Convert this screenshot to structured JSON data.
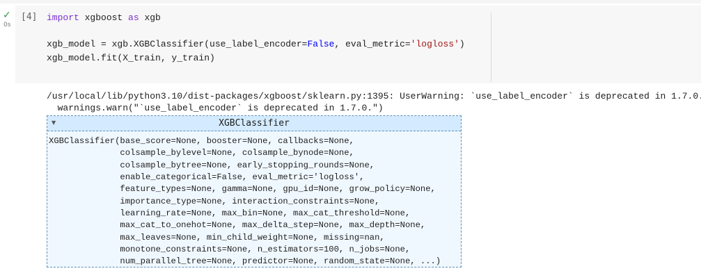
{
  "cell": {
    "status_icon": "check-icon",
    "elapsed": "0s",
    "execution_count": "[4]",
    "code": {
      "line1": {
        "kw_import": "import",
        "module": " xgboost ",
        "kw_as": "as",
        "alias": " xgb"
      },
      "line2": {
        "prefix": "xgb_model = xgb.XGBClassifier(use_label_encoder=",
        "false_lit": "False",
        "middle": ", eval_metric=",
        "metric_str": "'logloss'",
        "suffix": ")"
      },
      "line3": "xgb_model.fit(X_train, y_train)"
    }
  },
  "output": {
    "warning_line1": "/usr/local/lib/python3.10/dist-packages/xgboost/sklearn.py:1395: UserWarning: `use_label_encoder` is deprecated in 1.7.0.",
    "warning_line2": "  warnings.warn(\"`use_label_encoder` is deprecated in 1.7.0.\")",
    "estimator": {
      "toggle_icon": "triangle-down-icon",
      "title": "XGBClassifier",
      "repr_lines": [
        "XGBClassifier(base_score=None, booster=None, callbacks=None,",
        "              colsample_bylevel=None, colsample_bynode=None,",
        "              colsample_bytree=None, early_stopping_rounds=None,",
        "              enable_categorical=False, eval_metric='logloss',",
        "              feature_types=None, gamma=None, gpu_id=None, grow_policy=None,",
        "              importance_type=None, interaction_constraints=None,",
        "              learning_rate=None, max_bin=None, max_cat_threshold=None,",
        "              max_cat_to_onehot=None, max_delta_step=None, max_depth=None,",
        "              max_leaves=None, min_child_weight=None, missing=nan,",
        "              monotone_constraints=None, n_estimators=100, n_jobs=None,",
        "              num_parallel_tree=None, predictor=None, random_state=None, ...)"
      ]
    }
  }
}
